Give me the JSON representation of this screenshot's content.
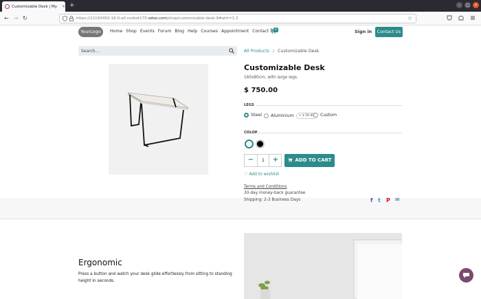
{
  "browser": {
    "tab_title": "Customizable Desk | My",
    "tab_close": "×",
    "new_tab": "+",
    "url_prefix": "https://22193450-16-0-all.runbot170.",
    "url_domain": "odoo.com",
    "url_path": "/shop/customizable-desk-9#attr=1,3",
    "back_icon": "←",
    "forward_icon": "→",
    "reload_icon": "↻",
    "star_icon": "☆"
  },
  "header": {
    "logo_text": "YourLogo",
    "menu": [
      "Home",
      "Shop",
      "Events",
      "Forum",
      "Blog",
      "Help",
      "Courses",
      "Appointment",
      "Contact us"
    ],
    "cart_count": "0",
    "sign_in": "Sign in",
    "contact_button": "Contact Us"
  },
  "search": {
    "placeholder": "Search..."
  },
  "breadcrumb": {
    "parent": "All Products",
    "separator": "/",
    "current": "Customizable Desk"
  },
  "product": {
    "title": "Customizable Desk",
    "description": "160x80cm, with large legs.",
    "price": "$ 750.00",
    "legs_label": "LEGS",
    "legs_options": [
      {
        "label": "Steel",
        "selected": true
      },
      {
        "label": "Aluminium",
        "selected": false,
        "extra": "+ $ 50.40"
      },
      {
        "label": "Custom",
        "selected": false
      }
    ],
    "color_label": "COLOR",
    "colors": [
      {
        "name": "white",
        "hex": "#f4f4f4",
        "selected": true
      },
      {
        "name": "black",
        "hex": "#000000",
        "selected": false
      }
    ],
    "quantity": "1",
    "qty_minus": "−",
    "qty_plus": "+",
    "add_to_cart": "ADD TO CART",
    "wishlist": "Add to wishlist",
    "terms": "Terms and Conditions",
    "guarantee": "30-day money-back guarantee",
    "shipping": "Shipping: 2-3 Business Days"
  },
  "share": {
    "facebook": "f",
    "twitter": "t",
    "pinterest": "P",
    "email": "✉"
  },
  "section": {
    "title": "Ergonomic",
    "text": "Press a button and watch your desk glide effortlessly from sitting to standing height in seconds."
  },
  "colors": {
    "accent": "#2c8b8b",
    "chat": "#7b4a6d"
  }
}
